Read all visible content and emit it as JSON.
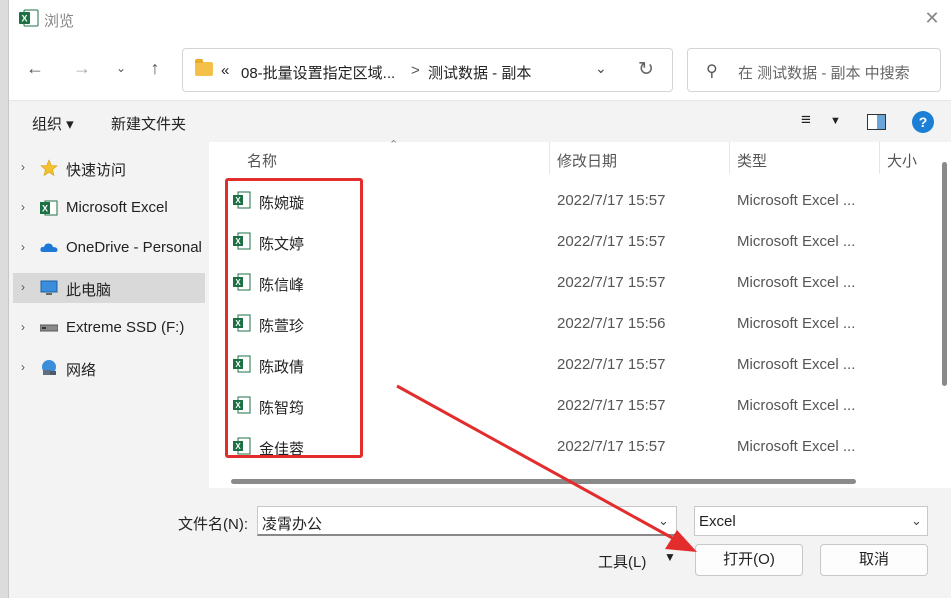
{
  "window": {
    "title": "浏览"
  },
  "nav": {
    "path_prefix": "«",
    "path_parent": "08-批量设置指定区域...",
    "path_sep": ">",
    "path_current": "测试数据 - 副本",
    "search_placeholder": "在 测试数据 - 副本 中搜索"
  },
  "toolbar": {
    "organize": "组织 ▾",
    "new_folder": "新建文件夹"
  },
  "sidebar": {
    "items": [
      {
        "label": "快速访问"
      },
      {
        "label": "Microsoft Excel"
      },
      {
        "label": "OneDrive - Personal"
      },
      {
        "label": "此电脑"
      },
      {
        "label": "Extreme SSD (F:)"
      },
      {
        "label": "网络"
      }
    ]
  },
  "columns": {
    "name": "名称",
    "date": "修改日期",
    "type": "类型",
    "size": "大小"
  },
  "files": [
    {
      "name": "陈婉璇",
      "date": "2022/7/17 15:57",
      "type": "Microsoft Excel ..."
    },
    {
      "name": "陈文婷",
      "date": "2022/7/17 15:57",
      "type": "Microsoft Excel ..."
    },
    {
      "name": "陈信峰",
      "date": "2022/7/17 15:57",
      "type": "Microsoft Excel ..."
    },
    {
      "name": "陈萱珍",
      "date": "2022/7/17 15:56",
      "type": "Microsoft Excel ..."
    },
    {
      "name": "陈政倩",
      "date": "2022/7/17 15:57",
      "type": "Microsoft Excel ..."
    },
    {
      "name": "陈智筠",
      "date": "2022/7/17 15:57",
      "type": "Microsoft Excel ..."
    },
    {
      "name": "金佳蓉",
      "date": "2022/7/17 15:57",
      "type": "Microsoft Excel ..."
    }
  ],
  "bottom": {
    "filename_label": "文件名(N):",
    "filename_value": "凌霄办公",
    "filetype_value": "Excel",
    "tools_label": "工具(L)",
    "open_label": "打开(O)",
    "cancel_label": "取消"
  },
  "colors": {
    "annotation_red": "#e32d2d",
    "excel_green": "#1d7044",
    "help_blue": "#1b7fd6"
  }
}
